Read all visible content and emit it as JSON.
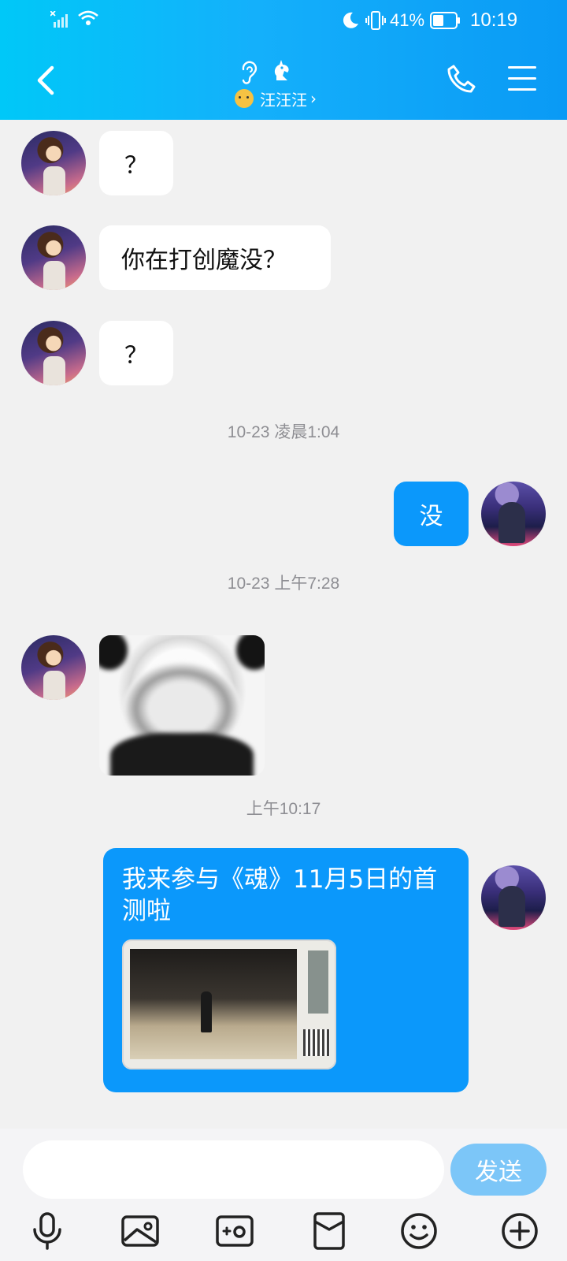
{
  "status_bar": {
    "battery_percent": "41%",
    "time": "10:19",
    "icons": [
      "no-sim-signal-icon",
      "wifi-icon",
      "moon-icon",
      "vibrate-icon",
      "battery-icon"
    ]
  },
  "header": {
    "contact_name": "汪汪汪",
    "chevron": "›",
    "icons": [
      "back-icon",
      "ear-icon",
      "horse-icon",
      "phone-icon",
      "menu-icon"
    ]
  },
  "messages": [
    {
      "side": "left",
      "text": "？"
    },
    {
      "side": "left",
      "text": "你在打创魔没？"
    },
    {
      "side": "left",
      "text": "？"
    },
    {
      "side": "time",
      "text": "10-23 凌晨1:04"
    },
    {
      "side": "right",
      "text": "没"
    },
    {
      "side": "time",
      "text": "10-23 上午7:28"
    },
    {
      "side": "left",
      "type": "sticker",
      "text": ""
    },
    {
      "side": "time",
      "text": "上午10:17"
    },
    {
      "side": "right",
      "type": "share-card",
      "text": "我来参与《魂》11月5日的首测啦"
    }
  ],
  "input": {
    "placeholder": "",
    "send_label": "发送"
  },
  "toolbar": [
    "microphone-icon",
    "image-icon",
    "camera-icon",
    "red-packet-icon",
    "emoji-icon",
    "plus-icon"
  ],
  "colors": {
    "accent": "#0b98fb",
    "header_gradient_start": "#00c8f8",
    "header_gradient_end": "#0a9af5",
    "send_disabled": "#7cc6f8",
    "background": "#f1f1f1"
  }
}
